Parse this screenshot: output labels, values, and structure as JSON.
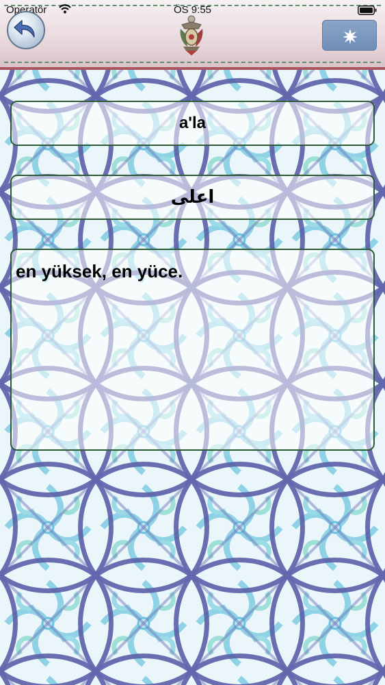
{
  "status_bar": {
    "carrier": "Operatör",
    "time": "ÖS 9:55"
  },
  "header": {
    "back_icon": "back-arrow-icon",
    "emblem_icon": "ottoman-coat-of-arms-icon",
    "settings_icon": "star-burst-icon"
  },
  "entry": {
    "word": "a'la",
    "arabic": "اعلى",
    "meaning": "en yüksek, en yüce."
  },
  "colors": {
    "header_border": "#a9545e",
    "card_border": "#2c5a36",
    "settings_button": "#7a97bf",
    "pattern_dark": "#5a5fa8",
    "pattern_light": "#6cc3df"
  }
}
